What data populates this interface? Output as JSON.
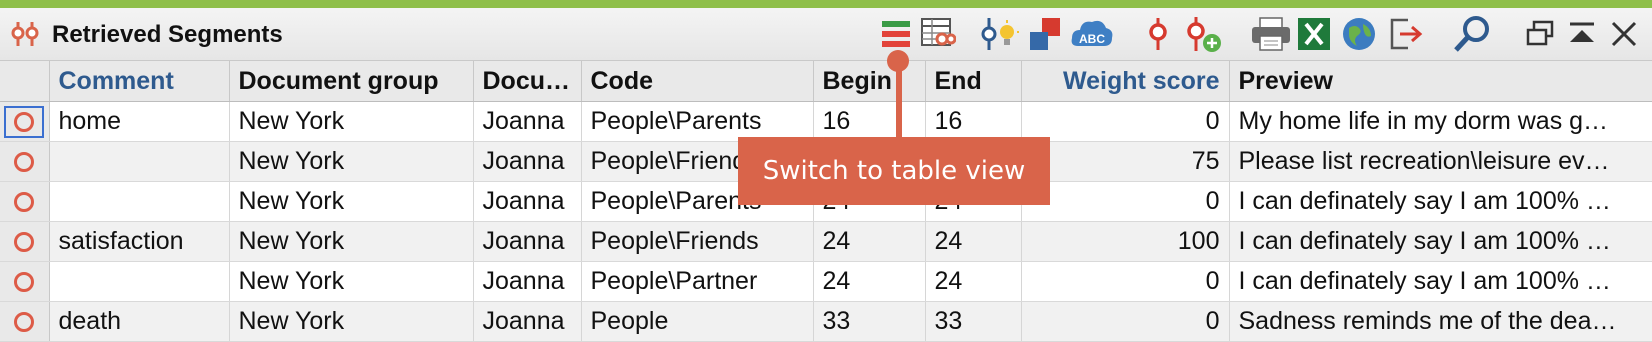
{
  "window": {
    "title": "Retrieved Segments",
    "accent_bar_color": "#8fbf4a"
  },
  "toolbar": {
    "icons": [
      "table-view-icon",
      "list-view-icon",
      "code-highlight-icon",
      "color-codes-icon",
      "word-cloud-icon",
      "code-icon",
      "add-code-icon",
      "print-icon",
      "excel-export-icon",
      "web-export-icon",
      "export-icon",
      "search-icon",
      "undock-window-icon",
      "collapse-icon",
      "close-icon"
    ],
    "word_cloud_icon_text": "ABC"
  },
  "tooltip": {
    "text": "Switch to table view",
    "color": "#d9644a"
  },
  "table": {
    "columns": [
      "Comment",
      "Document group",
      "Docu…",
      "Code",
      "Begin",
      "End",
      "Weight score",
      "Preview"
    ],
    "rows": [
      {
        "comment": "home",
        "group": "New York",
        "document": "Joanna",
        "code": "People\\Parents",
        "begin": "16",
        "end": "16",
        "weight": "0",
        "preview": "My home life in my dorm was g…"
      },
      {
        "comment": "",
        "group": "New York",
        "document": "Joanna",
        "code": "People\\Friends",
        "begin": "",
        "end": "",
        "weight": "75",
        "preview": "Please list recreation\\leisure ev…"
      },
      {
        "comment": "",
        "group": "New York",
        "document": "Joanna",
        "code": "People\\Parents",
        "begin": "24",
        "end": "24",
        "weight": "0",
        "preview": "I can definately say I am 100% …"
      },
      {
        "comment": "satisfaction",
        "group": "New York",
        "document": "Joanna",
        "code": "People\\Friends",
        "begin": "24",
        "end": "24",
        "weight": "100",
        "preview": "I can definately say I am 100% …"
      },
      {
        "comment": "",
        "group": "New York",
        "document": "Joanna",
        "code": "People\\Partner",
        "begin": "24",
        "end": "24",
        "weight": "0",
        "preview": "I can definately say I am 100% …"
      },
      {
        "comment": "death",
        "group": "New York",
        "document": "Joanna",
        "code": "People",
        "begin": "33",
        "end": "33",
        "weight": "0",
        "preview": "Sadness reminds me of the dea…"
      }
    ]
  }
}
